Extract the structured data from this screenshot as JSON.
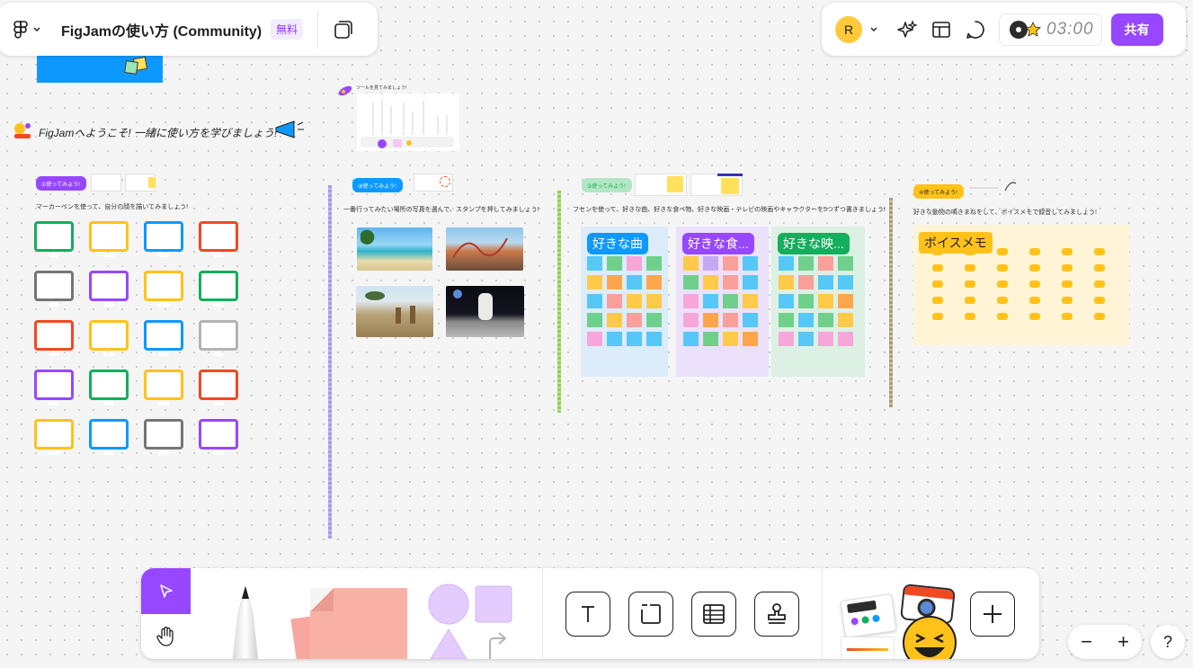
{
  "header": {
    "file_title": "FigJamの使い方 (Community)",
    "plan_badge": "無料",
    "user_initial": "R",
    "timer": "03:00",
    "share_label": "共有"
  },
  "canvas": {
    "welcome_text": "FigJamへようこそ! 一緒に使い方を学びましょう!",
    "tool_intro_text": "ツールを見てみましょう!",
    "sections": [
      {
        "pill": "①使ってみよう!",
        "instruction": "マーカーペンを使って、自分の顔を描いてみましょう!",
        "color": "#9747ff"
      },
      {
        "pill": "②使ってみよう!",
        "instruction": "一番行ってみたい場所の写真を選んで、スタンプを押してみましょう!",
        "color": "#0d99ff"
      },
      {
        "pill": "③使ってみよう!",
        "instruction": "フセンを使って、好きな曲、好きな食べ物、好きな映画・テレビの映画やキャラクターを5つずつ書きましょう!",
        "color": "#14ae5c"
      },
      {
        "pill": "④使ってみよう!",
        "instruction": "好きな動物の鳴きまねをして、ボイスメモで録音してみましょう!",
        "color": "#ffc21a"
      }
    ],
    "columns": [
      {
        "label": "好きな曲",
        "tag_color": "#0d99ff",
        "bg": "#dcecfb"
      },
      {
        "label": "好きな食...",
        "tag_color": "#9747ff",
        "bg": "#ece1fb"
      },
      {
        "label": "好きな映...",
        "tag_color": "#14ae5c",
        "bg": "#dcf1e4"
      }
    ],
    "voice_memo_label": "ボイスメモ",
    "colors": {
      "purple": "#9747ff",
      "blue": "#0d99ff",
      "green": "#14ae5c",
      "yellow": "#ffc21a",
      "red": "#f24822",
      "gray": "#757575"
    }
  },
  "toolbar": {
    "tools": [
      "select-tool",
      "hand-tool",
      "marker-tool",
      "sticky-note-tool",
      "shape-tool",
      "text-tool",
      "section-tool",
      "table-tool",
      "stamp-tool",
      "widgets-tool",
      "more-tool"
    ]
  },
  "zoom": {
    "minus": "−",
    "plus": "+"
  },
  "help_label": "?"
}
